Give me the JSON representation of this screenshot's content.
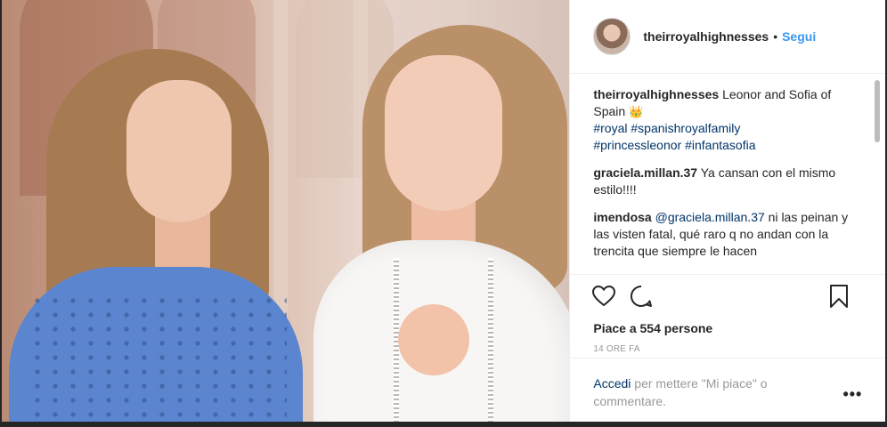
{
  "post": {
    "account": {
      "username": "theirroyalhighnesses",
      "separator": "•",
      "follow_label": "Segui"
    },
    "photo": {
      "alt_subject": "image"
    },
    "comments": [
      {
        "user": "theirroyalhighnesses",
        "text": "Leonor and Sofia of Spain",
        "emoji": "👑",
        "hashtags": [
          "#royal",
          "#spanishroyalfamily",
          "#princessleonor",
          "#infantasofia"
        ]
      },
      {
        "user": "graciela.millan.37",
        "text": "Ya cansan con el mismo estilo!!!!"
      },
      {
        "user": "imendosa",
        "mention": "@graciela.millan.37",
        "text": "ni las peinan y las visten fatal, qué raro q no andan con la trencita que siempre le hacen"
      }
    ],
    "actions": {
      "like_icon": "heart-icon",
      "comment_icon": "comment-icon",
      "save_icon": "bookmark-icon"
    },
    "likes_text": "Piace a 554 persone",
    "timestamp": "14 ORE FA",
    "add_comment": {
      "login_link": "Accedi",
      "rest_text": "per mettere \"Mi piace\" o commentare.",
      "more_label": "•••"
    }
  },
  "colors": {
    "link_blue": "#3897f0",
    "hashtag": "#003569",
    "muted": "#999999",
    "text": "#262626"
  }
}
